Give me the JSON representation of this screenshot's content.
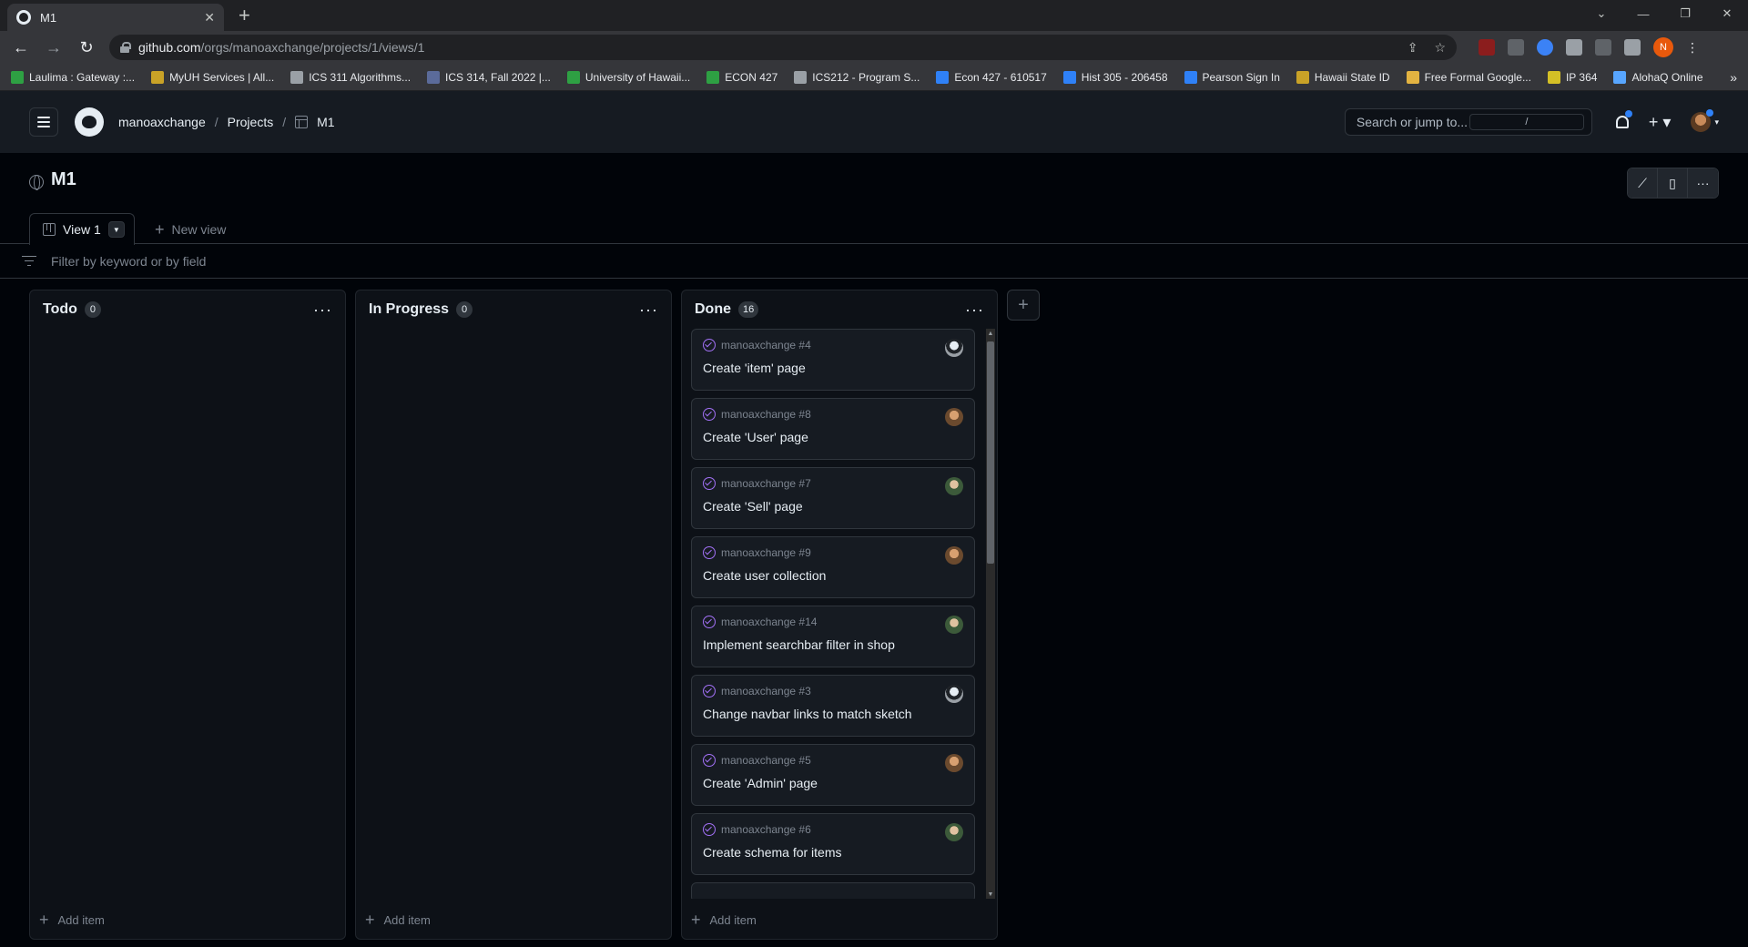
{
  "browser": {
    "tab_title": "M1",
    "url_host": "github.com",
    "url_path": "/orgs/manoaxchange/projects/1/views/1",
    "bookmarks": [
      {
        "label": "Laulima : Gateway :...",
        "color": "#2ea043"
      },
      {
        "label": "MyUH Services | All...",
        "color": "#c9a227"
      },
      {
        "label": "ICS 311 Algorithms...",
        "color": "#9aa0a6"
      },
      {
        "label": "ICS 314, Fall 2022 |...",
        "color": "#5b6b9a"
      },
      {
        "label": "University of Hawaii...",
        "color": "#2ea043"
      },
      {
        "label": "ECON 427",
        "color": "#2ea043"
      },
      {
        "label": "ICS212 - Program S...",
        "color": "#9aa0a6"
      },
      {
        "label": "Econ 427 - 610517",
        "color": "#2f81f7"
      },
      {
        "label": "Hist 305 - 206458",
        "color": "#2f81f7"
      },
      {
        "label": "Pearson Sign In",
        "color": "#2f81f7"
      },
      {
        "label": "Hawaii State ID",
        "color": "#c9a227"
      },
      {
        "label": "Free Formal Google...",
        "color": "#e3b341"
      },
      {
        "label": "IP 364",
        "color": "#d4c026"
      },
      {
        "label": "AlohaQ Online",
        "color": "#58a6ff"
      }
    ],
    "bookmarks_more": "»",
    "profile_initial": "N"
  },
  "header": {
    "org": "manoaxchange",
    "projects": "Projects",
    "project": "M1",
    "search_placeholder": "Search or jump to...",
    "search_shortcut": "/"
  },
  "project": {
    "title": "M1",
    "view_tab": "View 1",
    "new_view": "New view",
    "filter_placeholder": "Filter by keyword or by field"
  },
  "columns": [
    {
      "title": "Todo",
      "count": "0",
      "add_label": "Add item",
      "cards": []
    },
    {
      "title": "In Progress",
      "count": "0",
      "add_label": "Add item",
      "cards": []
    },
    {
      "title": "Done",
      "count": "16",
      "add_label": "Add item",
      "cards": [
        {
          "ref": "manoaxchange #4",
          "title": "Create 'item' page",
          "avatar": "a"
        },
        {
          "ref": "manoaxchange #8",
          "title": "Create 'User' page",
          "avatar": "b"
        },
        {
          "ref": "manoaxchange #7",
          "title": "Create 'Sell' page",
          "avatar": "c"
        },
        {
          "ref": "manoaxchange #9",
          "title": "Create user collection",
          "avatar": "b"
        },
        {
          "ref": "manoaxchange #14",
          "title": "Implement searchbar filter in shop",
          "avatar": "c"
        },
        {
          "ref": "manoaxchange #3",
          "title": "Change navbar links to match sketch",
          "avatar": "a"
        },
        {
          "ref": "manoaxchange #5",
          "title": "Create 'Admin' page",
          "avatar": "b"
        },
        {
          "ref": "manoaxchange #6",
          "title": "Create schema for items",
          "avatar": "c"
        }
      ]
    }
  ],
  "colors": {
    "done_icon": "#a371f7",
    "accent": "#2f81f7"
  }
}
